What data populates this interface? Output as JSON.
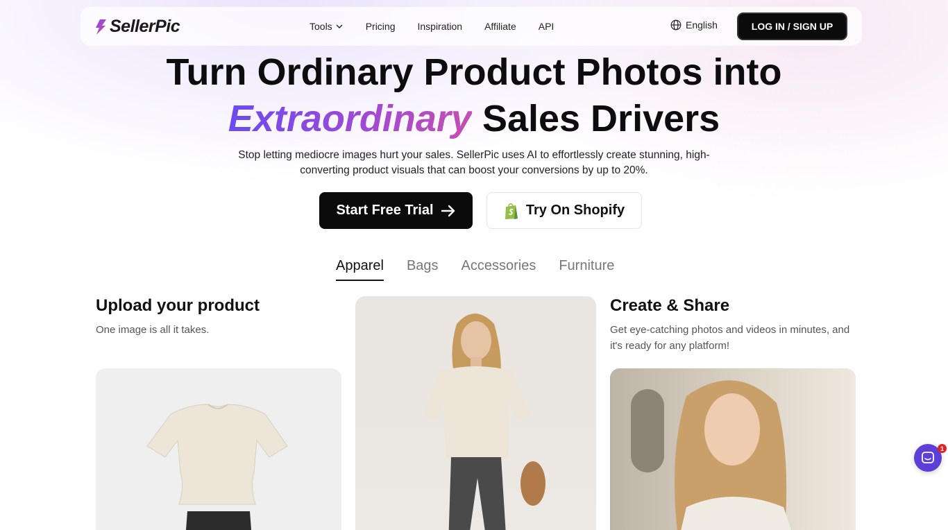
{
  "brand": {
    "name": "SellerPic"
  },
  "nav": {
    "links": [
      "Tools",
      "Pricing",
      "Inspiration",
      "Affiliate",
      "API"
    ],
    "language": "English",
    "login_label": "LOG IN / SIGN UP"
  },
  "hero": {
    "title_line1": "Turn Ordinary Product Photos into",
    "title_highlight": "Extraordinary",
    "title_rest": " Sales Drivers",
    "subtitle": "Stop letting mediocre images hurt your sales. SellerPic uses AI to effortlessly create stunning, high-converting product visuals that can boost your conversions by up to 20%.",
    "cta_primary": "Start Free Trial",
    "cta_secondary": "Try On Shopify"
  },
  "tabs": [
    {
      "label": "Apparel",
      "active": true
    },
    {
      "label": "Bags",
      "active": false
    },
    {
      "label": "Accessories",
      "active": false
    },
    {
      "label": "Furniture",
      "active": false
    }
  ],
  "steps": {
    "left": {
      "title": "Upload your product",
      "desc": "One image is all it takes."
    },
    "right": {
      "title": "Create & Share",
      "desc": "Get eye-catching photos and videos in minutes, and it's ready for any platform!"
    }
  },
  "chat": {
    "badge_count": "1"
  },
  "colors": {
    "accent_start": "#6a4cf0",
    "accent_end": "#c44fb0",
    "chat": "#5b3fd6"
  }
}
